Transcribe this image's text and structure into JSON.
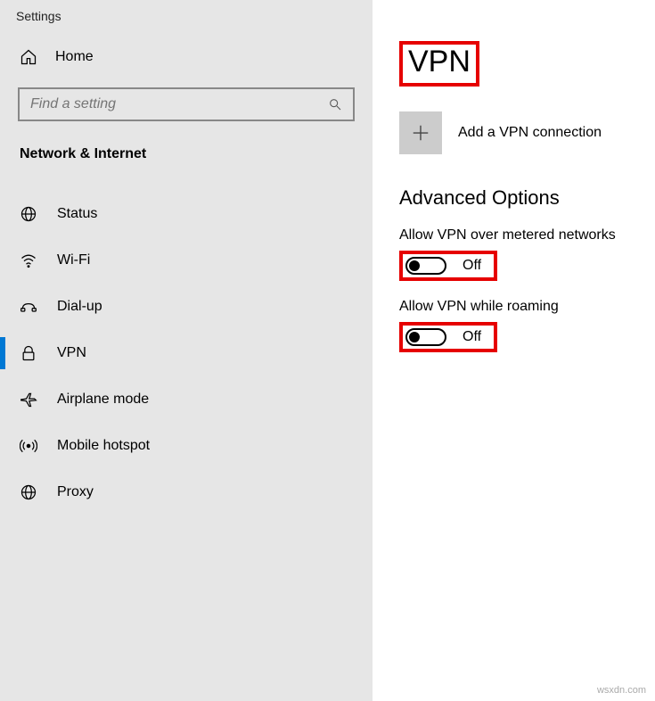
{
  "appTitle": "Settings",
  "home": {
    "label": "Home"
  },
  "search": {
    "placeholder": "Find a setting"
  },
  "category": "Network & Internet",
  "nav": [
    {
      "id": "status",
      "label": "Status",
      "active": false
    },
    {
      "id": "wifi",
      "label": "Wi-Fi",
      "active": false
    },
    {
      "id": "dialup",
      "label": "Dial-up",
      "active": false
    },
    {
      "id": "vpn",
      "label": "VPN",
      "active": true
    },
    {
      "id": "airplane",
      "label": "Airplane mode",
      "active": false
    },
    {
      "id": "hotspot",
      "label": "Mobile hotspot",
      "active": false
    },
    {
      "id": "proxy",
      "label": "Proxy",
      "active": false
    }
  ],
  "page": {
    "title": "VPN",
    "addConnection": "Add a VPN connection",
    "advancedTitle": "Advanced Options",
    "options": [
      {
        "label": "Allow VPN over metered networks",
        "state": "Off"
      },
      {
        "label": "Allow VPN while roaming",
        "state": "Off"
      }
    ]
  },
  "watermark": "wsxdn.com"
}
